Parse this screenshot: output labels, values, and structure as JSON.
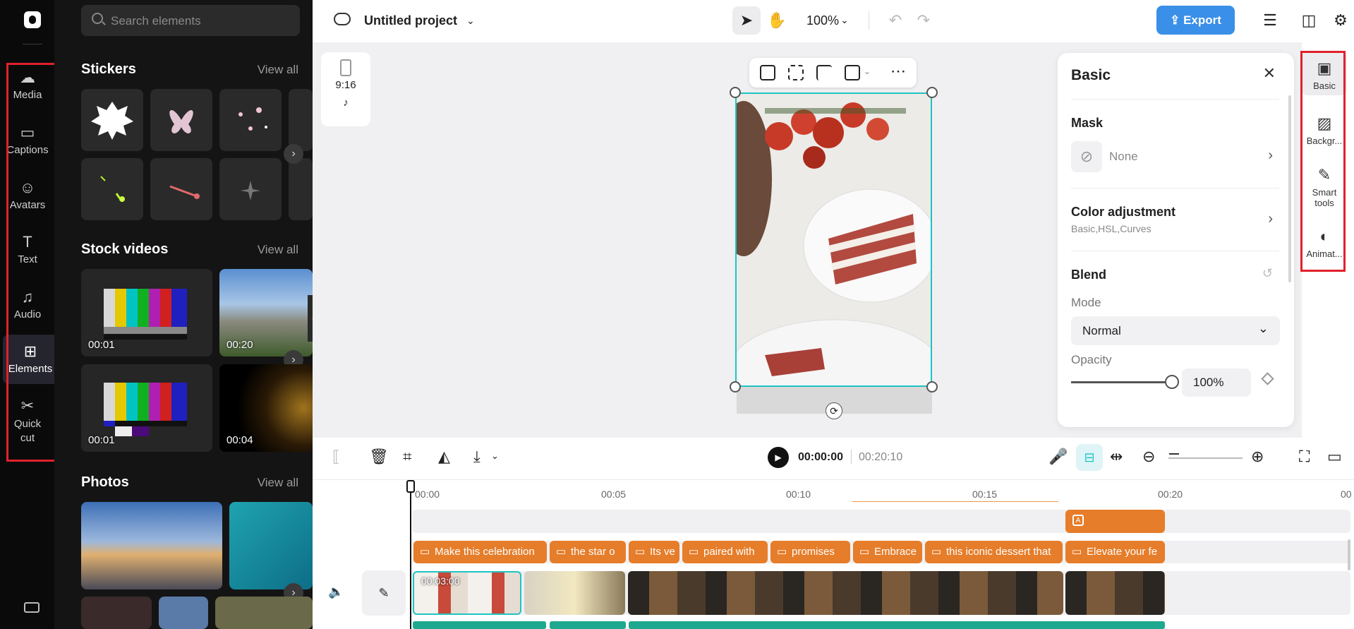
{
  "rail": {
    "items": [
      {
        "label": "Media",
        "icon": "cloud-upload-icon"
      },
      {
        "label": "Captions",
        "icon": "captions-icon"
      },
      {
        "label": "Avatars",
        "icon": "avatar-icon"
      },
      {
        "label": "Text",
        "icon": "text-icon"
      },
      {
        "label": "Audio",
        "icon": "music-note-icon"
      },
      {
        "label": "Elements",
        "icon": "elements-icon",
        "active": true
      },
      {
        "label": "Quick",
        "label2": "cut",
        "icon": "quick-cut-icon"
      }
    ]
  },
  "panel": {
    "search_placeholder": "Search elements",
    "stickers": {
      "title": "Stickers",
      "view_all": "View all"
    },
    "stock_videos": {
      "title": "Stock videos",
      "view_all": "View all",
      "durations": [
        "00:01",
        "00:20",
        "00:01",
        "00:04"
      ]
    },
    "photos": {
      "title": "Photos",
      "view_all": "View all"
    }
  },
  "topbar": {
    "project_title": "Untitled project",
    "zoom": "100%",
    "export_label": "Export"
  },
  "canvas": {
    "ratio": "9:16"
  },
  "props": {
    "title": "Basic",
    "mask_label": "Mask",
    "mask_value": "None",
    "color_adj_label": "Color adjustment",
    "color_adj_sub": "Basic,HSL,Curves",
    "blend_label": "Blend",
    "mode_label": "Mode",
    "mode_value": "Normal",
    "opacity_label": "Opacity",
    "opacity_value": "100%"
  },
  "right_rail": {
    "items": [
      {
        "label": "Basic",
        "icon": "image-icon"
      },
      {
        "label": "Backgr...",
        "icon": "background-icon"
      },
      {
        "label": "Smart",
        "label2": "tools",
        "icon": "magic-wand-icon"
      },
      {
        "label": "Animat...",
        "icon": "animation-icon"
      }
    ]
  },
  "timeline": {
    "current_time": "00:00:00",
    "total_time": "00:20:10",
    "ruler": [
      "00:00",
      "00:05",
      "00:10",
      "00:15",
      "00:20",
      "00"
    ],
    "captions": [
      "Make this celebration",
      "the star o",
      "Its ve",
      "paired with",
      "promises",
      "Embrace",
      "this iconic dessert that",
      "Elevate your fe"
    ],
    "clip_duration": "00:03:00"
  },
  "colors": {
    "accent": "#3a8fe8",
    "caption": "#e67d2a",
    "selection": "#1ec4c4",
    "highlight": "#e0212b"
  }
}
